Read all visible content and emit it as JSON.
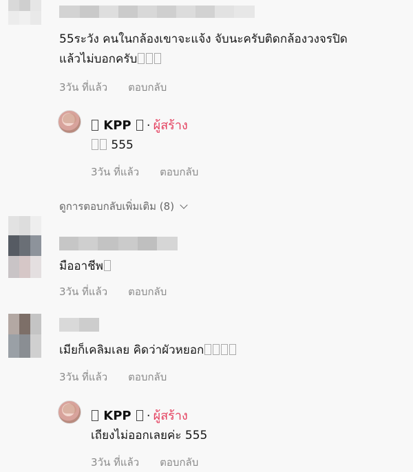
{
  "comments": [
    {
      "text_line1": "55ระวัง คนในกล้องเขาจะแจ้ง จับนะครับติดกล้องวงจรปิด",
      "text_line2": "แล้วไม่บอกครับ",
      "time": "3วัน ที่แล้ว",
      "reply_label": "ตอบกลับ",
      "replies": [
        {
          "username": "KPP",
          "badge": "ผู้สร้าง",
          "text": "555",
          "time": "3วัน ที่แล้ว",
          "reply_label": "ตอบกลับ"
        }
      ],
      "view_more": "ดูการตอบกลับเพิ่มเติม (8)"
    },
    {
      "text": "มืออาชีพ",
      "time": "3วัน ที่แล้ว",
      "reply_label": "ตอบกลับ"
    },
    {
      "text": "เมียก็เคลิมเลย คิดว่าผัวหยอก",
      "time": "3วัน ที่แล้ว",
      "reply_label": "ตอบกลับ",
      "replies": [
        {
          "username": "KPP",
          "badge": "ผู้สร้าง",
          "text": "เถียงไม่ออกเลยค่ะ 555",
          "time": "3วัน ที่แล้ว",
          "reply_label": "ตอบกลับ"
        }
      ]
    }
  ],
  "colors": {
    "creator_badge": "#e4405f",
    "meta": "#8a8a8a"
  }
}
